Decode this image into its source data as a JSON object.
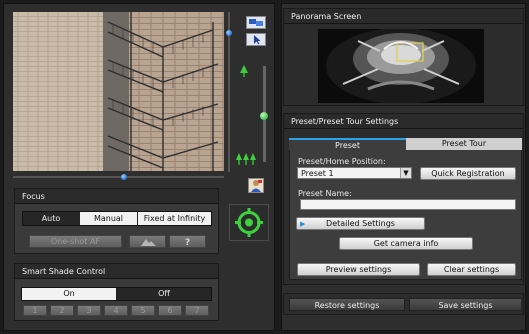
{
  "left": {
    "focus": {
      "header": "Focus",
      "modes": [
        "Auto",
        "Manual",
        "Fixed at Infinity"
      ],
      "selected": "Auto",
      "oneshot": "One-shot AF"
    },
    "smart_shade": {
      "header": "Smart Shade Control",
      "on": "On",
      "off": "Off",
      "selected": "On",
      "levels": [
        "1",
        "2",
        "3",
        "4",
        "5",
        "6",
        "7"
      ]
    }
  },
  "right": {
    "panorama": {
      "header": "Panorama Screen"
    },
    "preset": {
      "header": "Preset/Preset Tour Settings",
      "tabs": [
        "Preset",
        "Preset Tour"
      ],
      "active_tab": "Preset",
      "home_label": "Preset/Home Position:",
      "home_value": "Preset 1",
      "quick_registration": "Quick Registration",
      "name_label": "Preset Name:",
      "name_value": "",
      "detailed_settings": "Detailed Settings",
      "camera_info": "Get camera info",
      "preview": "Preview settings",
      "clear": "Clear settings"
    },
    "restore": "Restore settings",
    "save": "Save settings"
  }
}
